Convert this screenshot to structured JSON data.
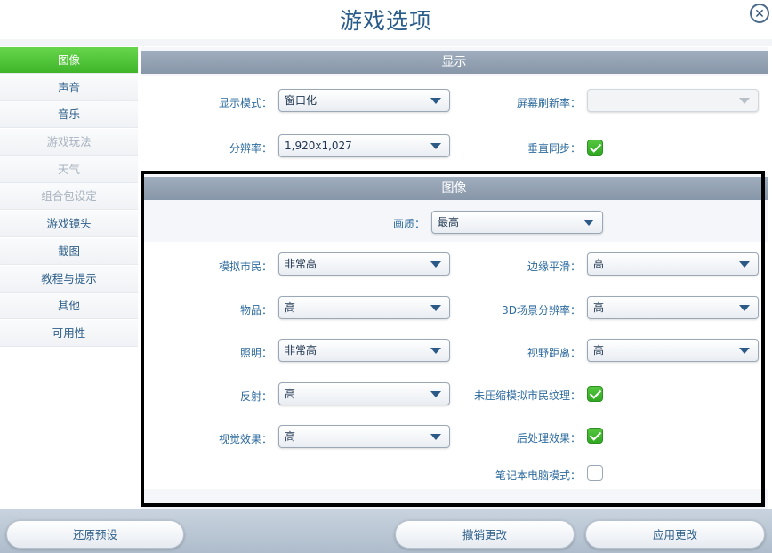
{
  "window": {
    "title": "游戏选项"
  },
  "sidebar": {
    "items": [
      {
        "label": "图像",
        "state": "active"
      },
      {
        "label": "声音",
        "state": "normal"
      },
      {
        "label": "音乐",
        "state": "normal"
      },
      {
        "label": "游戏玩法",
        "state": "disabled"
      },
      {
        "label": "天气",
        "state": "disabled"
      },
      {
        "label": "组合包设定",
        "state": "disabled"
      },
      {
        "label": "游戏镜头",
        "state": "normal"
      },
      {
        "label": "截图",
        "state": "normal"
      },
      {
        "label": "教程与提示",
        "state": "normal"
      },
      {
        "label": "其他",
        "state": "normal"
      },
      {
        "label": "可用性",
        "state": "normal"
      }
    ]
  },
  "display": {
    "header": "显示",
    "display_mode": {
      "label": "显示模式：",
      "value": "窗口化"
    },
    "refresh_rate": {
      "label": "屏幕刷新率：",
      "value": ""
    },
    "resolution": {
      "label": "分辨率：",
      "value": "1,920x1,027"
    },
    "vsync": {
      "label": "垂直同步：",
      "checked": true
    }
  },
  "graphics": {
    "header": "图像",
    "quality": {
      "label": "画质：",
      "value": "最高"
    },
    "sim_detail": {
      "label": "模拟市民：",
      "value": "非常高"
    },
    "edge_smoothing": {
      "label": "边缘平滑：",
      "value": "高"
    },
    "objects": {
      "label": "物品：",
      "value": "高"
    },
    "scene_resolution": {
      "label": "3D场景分辨率：",
      "value": "高"
    },
    "lighting": {
      "label": "照明：",
      "value": "非常高"
    },
    "view_distance": {
      "label": "视野距离：",
      "value": "高"
    },
    "reflections": {
      "label": "反射：",
      "value": "高"
    },
    "uncompressed_textures": {
      "label": "未压缩模拟市民纹理：",
      "checked": true
    },
    "visual_effects": {
      "label": "视觉效果：",
      "value": "高"
    },
    "post_processing": {
      "label": "后处理效果：",
      "checked": true
    },
    "laptop_mode": {
      "label": "笔记本电脑模式：",
      "checked": false
    }
  },
  "footer": {
    "restore_defaults": "还原预设",
    "cancel_changes": "撤销更改",
    "apply_changes": "应用更改"
  },
  "colors": {
    "accent_green": "#3fb52a",
    "label_blue": "#2e6b9e",
    "header_gray": "#8796a8"
  }
}
